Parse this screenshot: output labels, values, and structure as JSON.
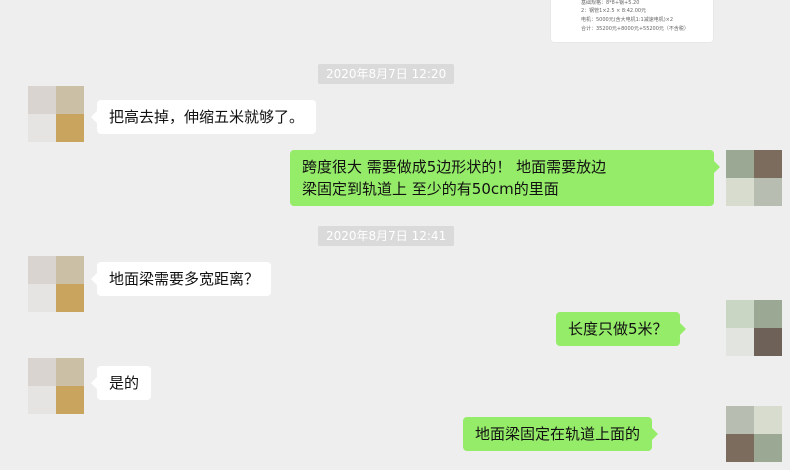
{
  "image_preview": {
    "lines": [
      "基础规格：8*8+钢+5.20",
      "2：钢管1×2.5 × 8:42.00元",
      "电机：5000元(含大电机1:1减速电机)×2",
      "合计：35200元+8000元+55200元（不含税）"
    ]
  },
  "messages": [
    {
      "type": "timestamp",
      "text": "2020年8月7日 12:20"
    },
    {
      "type": "text",
      "side": "left",
      "text": "把高去掉，伸缩五米就够了。"
    },
    {
      "type": "text",
      "side": "right",
      "lines": [
        "跨度很大  需要做成5边形状的！ 地面需要放边",
        "梁固定到轨道上  至少的有50cm的里面"
      ]
    },
    {
      "type": "timestamp",
      "text": "2020年8月7日 12:41"
    },
    {
      "type": "text",
      "side": "left",
      "text": "地面梁需要多宽距离？"
    },
    {
      "type": "text",
      "side": "right",
      "text": "长度只做5米？"
    },
    {
      "type": "text",
      "side": "left",
      "text": "是的"
    },
    {
      "type": "text",
      "side": "right",
      "text": "地面梁固定在轨道上面的"
    }
  ],
  "colors": {
    "background": "#eeeeee",
    "bubble_self": "#95ec69",
    "bubble_other": "#ffffff",
    "timestamp_bg": "#dadada"
  }
}
